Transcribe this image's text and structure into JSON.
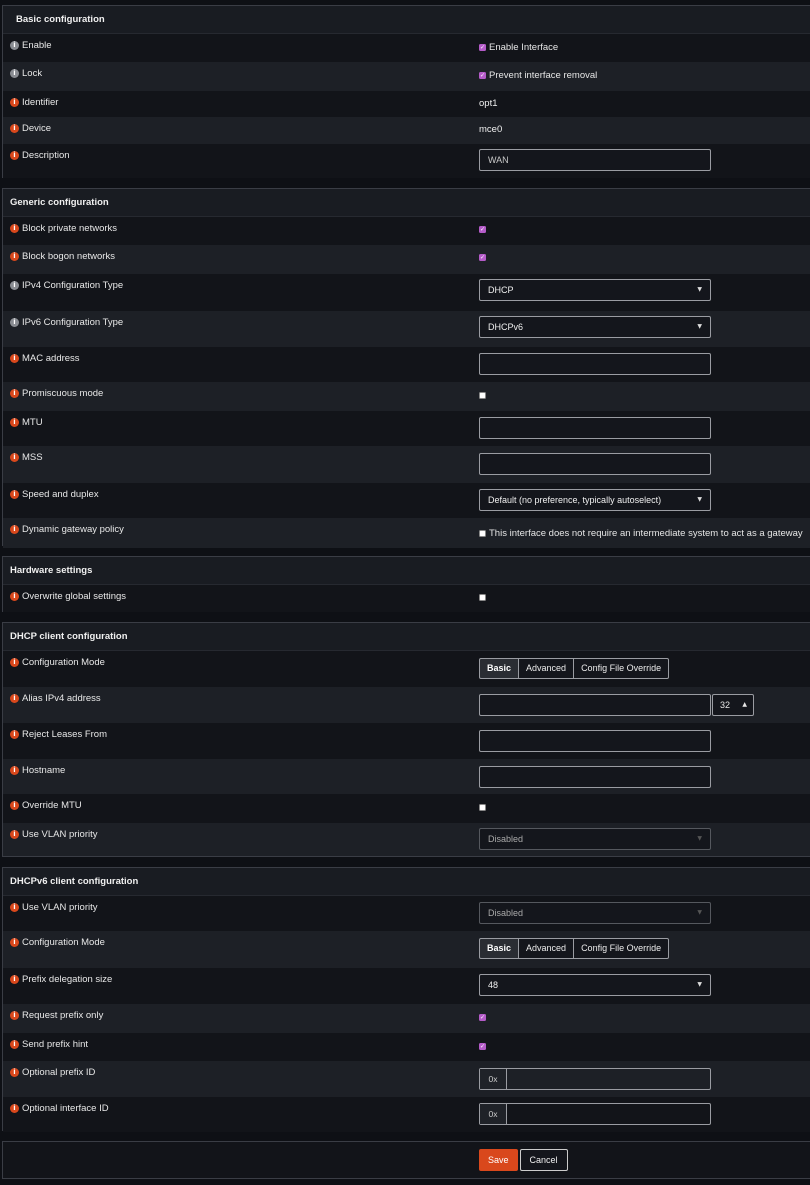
{
  "basic": {
    "title": "Basic configuration",
    "enable": {
      "label": "Enable",
      "checkbox_label": "Enable Interface"
    },
    "lock": {
      "label": "Lock",
      "checkbox_label": "Prevent interface removal"
    },
    "identifier": {
      "label": "Identifier",
      "value": "opt1"
    },
    "device": {
      "label": "Device",
      "value": "mce0"
    },
    "description": {
      "label": "Description",
      "value": "WAN"
    }
  },
  "generic": {
    "title": "Generic configuration",
    "block_private": {
      "label": "Block private networks"
    },
    "block_bogon": {
      "label": "Block bogon networks"
    },
    "ipv4_type": {
      "label": "IPv4 Configuration Type",
      "value": "DHCP"
    },
    "ipv6_type": {
      "label": "IPv6 Configuration Type",
      "value": "DHCPv6"
    },
    "mac": {
      "label": "MAC address",
      "value": ""
    },
    "promisc": {
      "label": "Promiscuous mode"
    },
    "mtu": {
      "label": "MTU",
      "value": ""
    },
    "mss": {
      "label": "MSS",
      "value": ""
    },
    "speed": {
      "label": "Speed and duplex",
      "value": "Default (no preference, typically autoselect)"
    },
    "gateway": {
      "label": "Dynamic gateway policy",
      "checkbox_label": "This interface does not require an intermediate system to act as a gateway"
    }
  },
  "hardware": {
    "title": "Hardware settings",
    "overwrite": {
      "label": "Overwrite global settings"
    }
  },
  "dhcp": {
    "title": "DHCP client configuration",
    "mode": {
      "label": "Configuration Mode",
      "options": [
        "Basic",
        "Advanced",
        "Config File Override"
      ]
    },
    "alias": {
      "label": "Alias IPv4 address",
      "value": "",
      "cidr": "32"
    },
    "reject": {
      "label": "Reject Leases From",
      "value": ""
    },
    "hostname": {
      "label": "Hostname",
      "value": ""
    },
    "override_mtu": {
      "label": "Override MTU"
    },
    "vlan": {
      "label": "Use VLAN priority",
      "value": "Disabled"
    }
  },
  "dhcp6": {
    "title": "DHCPv6 client configuration",
    "vlan": {
      "label": "Use VLAN priority",
      "value": "Disabled"
    },
    "mode": {
      "label": "Configuration Mode",
      "options": [
        "Basic",
        "Advanced",
        "Config File Override"
      ]
    },
    "prefix_size": {
      "label": "Prefix delegation size",
      "value": "48"
    },
    "req_prefix": {
      "label": "Request prefix only"
    },
    "prefix_hint": {
      "label": "Send prefix hint"
    },
    "prefix_id": {
      "label": "Optional prefix ID",
      "addon": "0x",
      "value": ""
    },
    "iface_id": {
      "label": "Optional interface ID",
      "addon": "0x",
      "value": ""
    }
  },
  "footer": {
    "save_label": "Save",
    "cancel_label": "Cancel"
  },
  "icons": {
    "info": "info-icon",
    "caret": "caret-down-icon",
    "check": "check-icon"
  },
  "colors": {
    "accent": "#d9481c",
    "checkbox": "#b45bc8",
    "background": "#14161c"
  }
}
